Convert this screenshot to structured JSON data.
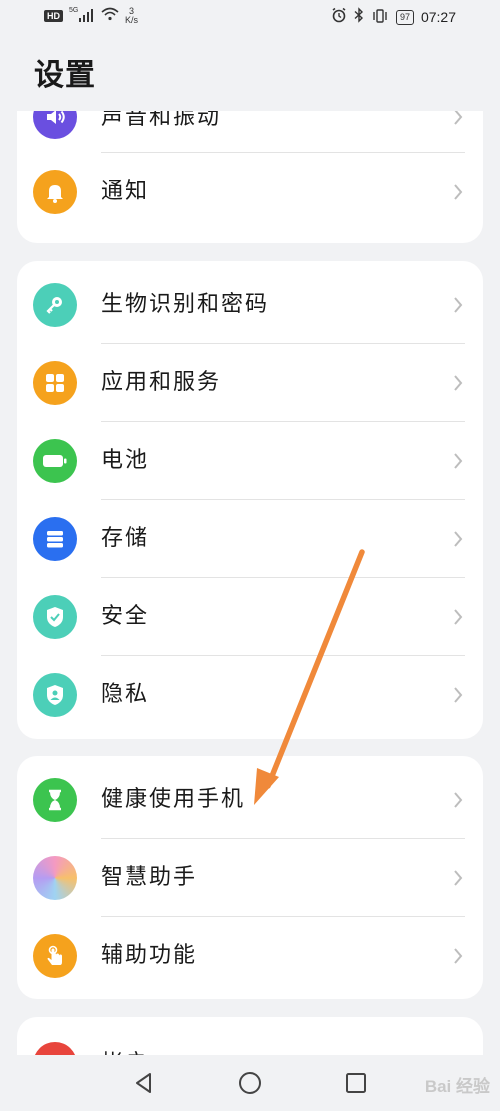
{
  "status_bar": {
    "hd_badge": "HD",
    "network": "5G",
    "net_speed_value": "3",
    "net_speed_unit": "K/s",
    "battery_level": "97",
    "time": "07:27"
  },
  "page": {
    "title": "设置"
  },
  "cards": [
    {
      "rows": [
        {
          "label": "声音和振动",
          "icon": "volume-icon",
          "color": "#6a4fe0"
        },
        {
          "label": "通知",
          "icon": "bell-icon",
          "color": "#f5a21d"
        }
      ]
    },
    {
      "rows": [
        {
          "label": "生物识别和密码",
          "icon": "key-icon",
          "color": "#4ccfb8"
        },
        {
          "label": "应用和服务",
          "icon": "apps-grid-icon",
          "color": "#f5a21d"
        },
        {
          "label": "电池",
          "icon": "battery-icon",
          "color": "#3cc44f"
        },
        {
          "label": "存储",
          "icon": "storage-icon",
          "color": "#2a6ff0"
        },
        {
          "label": "安全",
          "icon": "shield-check-icon",
          "color": "#4ccfb8"
        },
        {
          "label": "隐私",
          "icon": "privacy-shield-icon",
          "color": "#4ccfb8"
        }
      ]
    },
    {
      "rows": [
        {
          "label": "健康使用手机",
          "icon": "hourglass-icon",
          "color": "#3cc44f"
        },
        {
          "label": "智慧助手",
          "icon": "assistant-orb-icon",
          "color": "#f49ac1"
        },
        {
          "label": "辅助功能",
          "icon": "hand-tap-icon",
          "color": "#f5a21d"
        }
      ]
    },
    {
      "rows": [
        {
          "label": "帐户",
          "icon": "account-icon",
          "color": "#e8453c"
        }
      ]
    }
  ],
  "annotation": {
    "color": "#f0893a"
  },
  "nav": {
    "back": "back-triangle-icon",
    "home": "home-circle-icon",
    "recents": "recents-square-icon"
  },
  "watermark": "Bai 经验"
}
